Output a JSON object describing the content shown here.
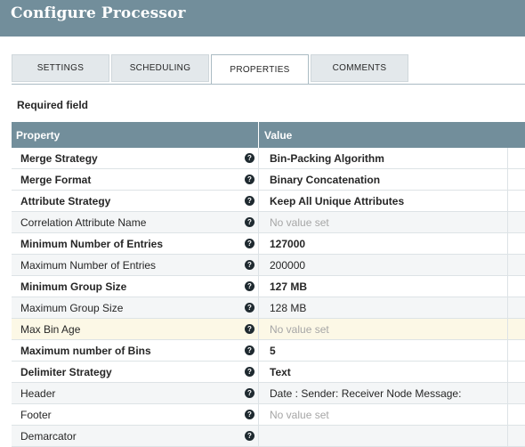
{
  "header": {
    "title": "Configure Processor"
  },
  "tabs": [
    {
      "label": "SETTINGS"
    },
    {
      "label": "SCHEDULING"
    },
    {
      "label": "PROPERTIES"
    },
    {
      "label": "COMMENTS"
    }
  ],
  "required_label": "Required field",
  "grid": {
    "col_property": "Property",
    "col_value": "Value",
    "help_glyph": "?",
    "rows": [
      {
        "name": "Merge Strategy",
        "value": "Bin-Packing Algorithm"
      },
      {
        "name": "Merge Format",
        "value": "Binary Concatenation"
      },
      {
        "name": "Attribute Strategy",
        "value": "Keep All Unique Attributes"
      },
      {
        "name": "Correlation Attribute Name",
        "value": "No value set"
      },
      {
        "name": "Minimum Number of Entries",
        "value": "127000"
      },
      {
        "name": "Maximum Number of Entries",
        "value": "200000"
      },
      {
        "name": "Minimum Group Size",
        "value": "127 MB"
      },
      {
        "name": "Maximum Group Size",
        "value": "128 MB"
      },
      {
        "name": "Max Bin Age",
        "value": "No value set"
      },
      {
        "name": "Maximum number of Bins",
        "value": "5"
      },
      {
        "name": "Delimiter Strategy",
        "value": "Text"
      },
      {
        "name": "Header",
        "value": "Date : Sender: Receiver Node Message:"
      },
      {
        "name": "Footer",
        "value": "No value set"
      },
      {
        "name": "Demarcator",
        "value": ""
      }
    ]
  }
}
